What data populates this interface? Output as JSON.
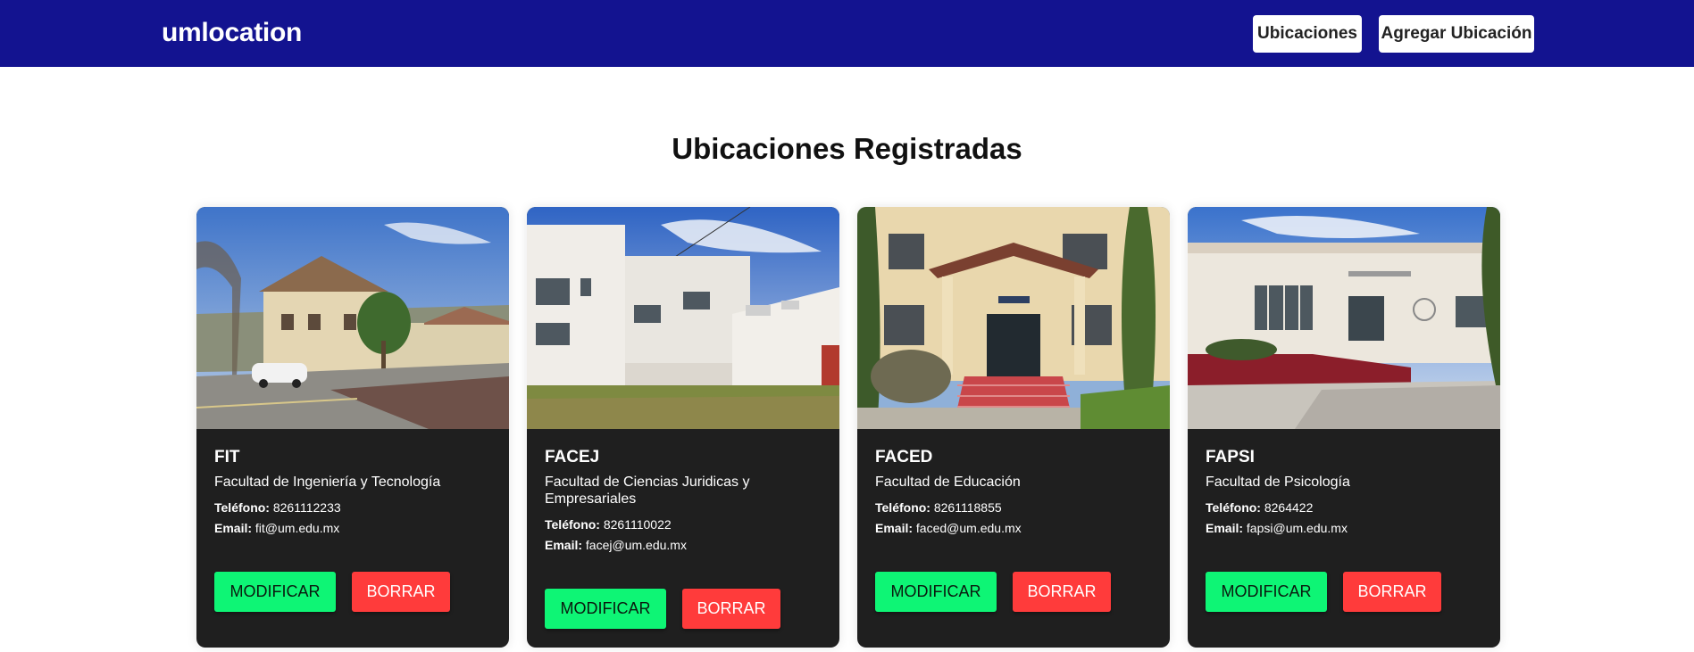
{
  "navbar": {
    "brand": "umlocation",
    "links": [
      {
        "label": "Ubicaciones"
      },
      {
        "label": "Agregar Ubicación"
      }
    ]
  },
  "page": {
    "title": "Ubicaciones Registradas"
  },
  "cards": [
    {
      "code": "FIT",
      "name": "Facultad de Ingeniería y Tecnología",
      "phone_label": "Teléfono:",
      "phone": "8261112233",
      "email_label": "Email:",
      "email": "fit@um.edu.mx",
      "modify_label": "MODIFICAR",
      "delete_label": "BORRAR"
    },
    {
      "code": "FACEJ",
      "name": "Facultad de Ciencias Juridicas y Empresariales",
      "phone_label": "Teléfono:",
      "phone": "8261110022",
      "email_label": "Email:",
      "email": "facej@um.edu.mx",
      "modify_label": "MODIFICAR",
      "delete_label": "BORRAR"
    },
    {
      "code": "FACED",
      "name": "Facultad de Educación",
      "phone_label": "Teléfono:",
      "phone": "8261118855",
      "email_label": "Email:",
      "email": "faced@um.edu.mx",
      "modify_label": "MODIFICAR",
      "delete_label": "BORRAR"
    },
    {
      "code": "FAPSI",
      "name": "Facultad de Psicología",
      "phone_label": "Teléfono:",
      "phone": "8264422",
      "email_label": "Email:",
      "email": "fapsi@um.edu.mx",
      "modify_label": "MODIFICAR",
      "delete_label": "BORRAR"
    }
  ],
  "colors": {
    "navbar": "#131390",
    "card": "#1f1f1f",
    "modify": "#0ef575",
    "delete": "#ff3b3b"
  }
}
